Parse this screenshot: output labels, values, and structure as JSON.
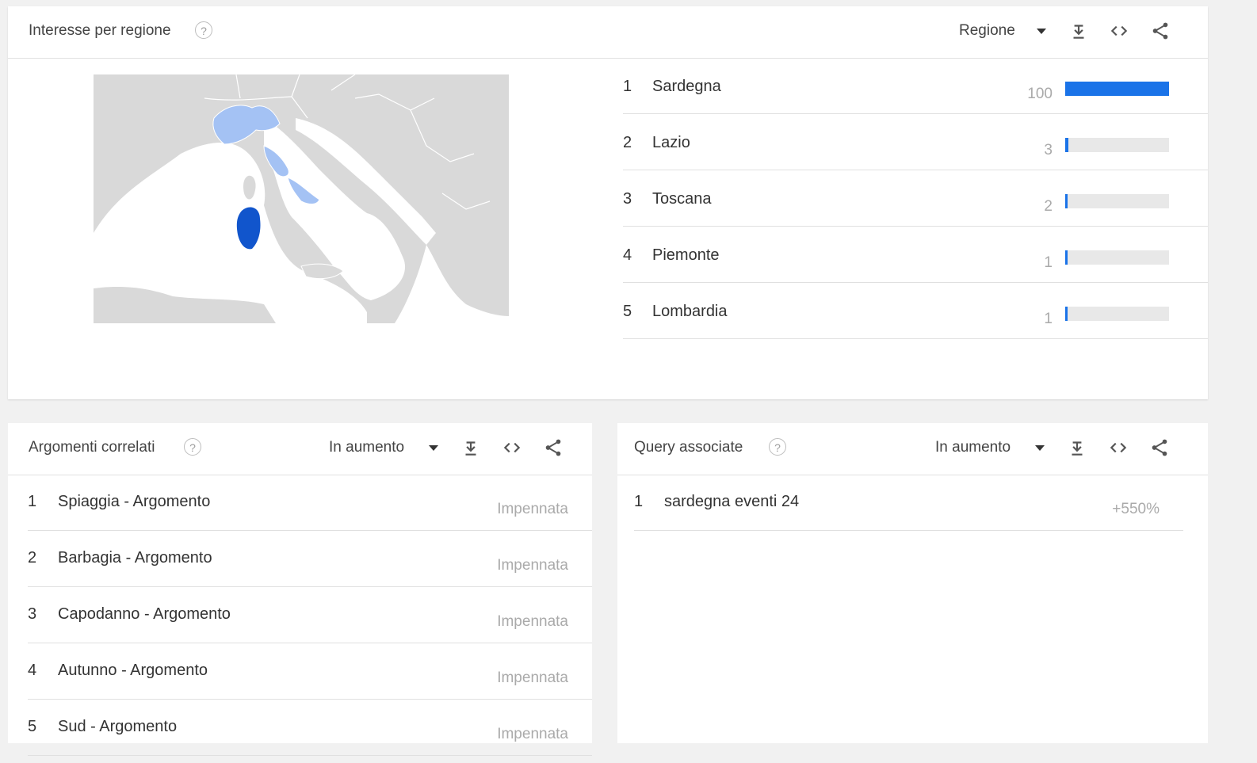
{
  "region_card": {
    "title": "Interesse per regione",
    "help": "?",
    "selector": "Regione",
    "icons": [
      "download-icon",
      "embed-icon",
      "share-icon"
    ],
    "rankings": [
      {
        "rank": "1",
        "name": "Sardegna",
        "value": "100",
        "share": 1.0
      },
      {
        "rank": "2",
        "name": "Lazio",
        "value": "3",
        "share": 0.03
      },
      {
        "rank": "3",
        "name": "Toscana",
        "value": "2",
        "share": 0.02
      },
      {
        "rank": "4",
        "name": "Piemonte",
        "value": "1",
        "share": 0.01
      },
      {
        "rank": "5",
        "name": "Lombardia",
        "value": "1",
        "share": 0.01
      }
    ],
    "colors": {
      "bar": "#1a73e8",
      "top_region": "#1155cc",
      "light_region": "#a4c2f4",
      "land": "#d9d9d9"
    }
  },
  "topics_card": {
    "title": "Argomenti correlati",
    "help": "?",
    "selector": "In aumento",
    "items": [
      {
        "rank": "1",
        "name": "Spiaggia - Argomento",
        "value": "Impennata"
      },
      {
        "rank": "2",
        "name": "Barbagia - Argomento",
        "value": "Impennata"
      },
      {
        "rank": "3",
        "name": "Capodanno - Argomento",
        "value": "Impennata"
      },
      {
        "rank": "4",
        "name": "Autunno - Argomento",
        "value": "Impennata"
      },
      {
        "rank": "5",
        "name": "Sud - Argomento",
        "value": "Impennata"
      }
    ]
  },
  "queries_card": {
    "title": "Query associate",
    "help": "?",
    "selector": "In aumento",
    "items": [
      {
        "rank": "1",
        "name": "sardegna eventi 24",
        "value": "+550%"
      }
    ]
  }
}
